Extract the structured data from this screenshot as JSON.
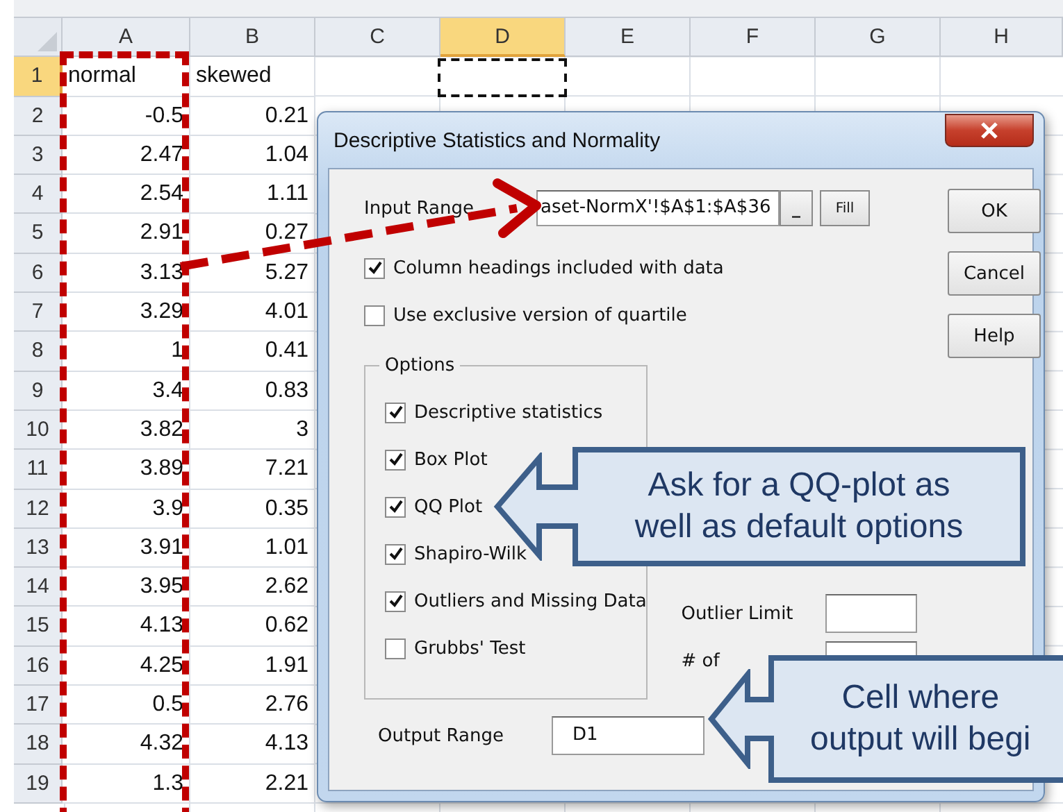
{
  "spreadsheet": {
    "columns": [
      {
        "label": "A",
        "selected": false
      },
      {
        "label": "B",
        "selected": false
      },
      {
        "label": "C",
        "selected": false
      },
      {
        "label": "D",
        "selected": true
      },
      {
        "label": "E",
        "selected": false
      },
      {
        "label": "F",
        "selected": false
      },
      {
        "label": "G",
        "selected": false
      },
      {
        "label": "H",
        "selected": false
      }
    ],
    "rows": [
      {
        "number": "1",
        "selected": true,
        "kind": "text",
        "cells": [
          "normal",
          "skewed"
        ]
      },
      {
        "number": "2",
        "selected": false,
        "kind": "number",
        "cells": [
          "-0.5",
          "0.21"
        ]
      },
      {
        "number": "3",
        "selected": false,
        "kind": "number",
        "cells": [
          "2.47",
          "1.04"
        ]
      },
      {
        "number": "4",
        "selected": false,
        "kind": "number",
        "cells": [
          "2.54",
          "1.11"
        ]
      },
      {
        "number": "5",
        "selected": false,
        "kind": "number",
        "cells": [
          "2.91",
          "0.27"
        ]
      },
      {
        "number": "6",
        "selected": false,
        "kind": "number",
        "cells": [
          "3.13",
          "5.27"
        ]
      },
      {
        "number": "7",
        "selected": false,
        "kind": "number",
        "cells": [
          "3.29",
          "4.01"
        ]
      },
      {
        "number": "8",
        "selected": false,
        "kind": "number",
        "cells": [
          "1",
          "0.41"
        ]
      },
      {
        "number": "9",
        "selected": false,
        "kind": "number",
        "cells": [
          "3.4",
          "0.83"
        ]
      },
      {
        "number": "10",
        "selected": false,
        "kind": "number",
        "cells": [
          "3.82",
          "3"
        ]
      },
      {
        "number": "11",
        "selected": false,
        "kind": "number",
        "cells": [
          "3.89",
          "7.21"
        ]
      },
      {
        "number": "12",
        "selected": false,
        "kind": "number",
        "cells": [
          "3.9",
          "0.35"
        ]
      },
      {
        "number": "13",
        "selected": false,
        "kind": "number",
        "cells": [
          "3.91",
          "1.01"
        ]
      },
      {
        "number": "14",
        "selected": false,
        "kind": "number",
        "cells": [
          "3.95",
          "2.62"
        ]
      },
      {
        "number": "15",
        "selected": false,
        "kind": "number",
        "cells": [
          "4.13",
          "0.62"
        ]
      },
      {
        "number": "16",
        "selected": false,
        "kind": "number",
        "cells": [
          "4.25",
          "1.91"
        ]
      },
      {
        "number": "17",
        "selected": false,
        "kind": "number",
        "cells": [
          "0.5",
          "2.76"
        ]
      },
      {
        "number": "18",
        "selected": false,
        "kind": "number",
        "cells": [
          "4.32",
          "4.13"
        ]
      },
      {
        "number": "19",
        "selected": false,
        "kind": "number",
        "cells": [
          "1.3",
          "2.21"
        ]
      }
    ]
  },
  "dialog": {
    "title": "Descriptive Statistics and Normality",
    "input_range": {
      "label": "Input Range",
      "value": "aset-NormX'!$A$1:$A$36",
      "collapse_button": "_",
      "fill_button": "Fill"
    },
    "checks": [
      {
        "label": "Column headings included with data",
        "checked": true
      },
      {
        "label": "Use exclusive version of quartile",
        "checked": false
      }
    ],
    "options": {
      "title": "Options",
      "items": [
        {
          "label": "Descriptive statistics",
          "checked": true
        },
        {
          "label": "Box Plot",
          "checked": true
        },
        {
          "label": "QQ Plot",
          "checked": true
        },
        {
          "label": "Shapiro-Wilk",
          "checked": true
        },
        {
          "label": "Outliers and Missing Data",
          "checked": true
        },
        {
          "label": "Grubbs' Test",
          "checked": false
        }
      ]
    },
    "outlier_limit": {
      "label": "Outlier Limit"
    },
    "outlier_count": {
      "label": "# of"
    },
    "output_range": {
      "label": "Output Range",
      "value": "D1"
    },
    "buttons": [
      "OK",
      "Cancel",
      "Help"
    ]
  },
  "callouts": [
    {
      "lines": [
        "Ask for a QQ-plot as",
        "well as default options"
      ]
    },
    {
      "lines": [
        "Cell where",
        "output will begi"
      ]
    }
  ]
}
